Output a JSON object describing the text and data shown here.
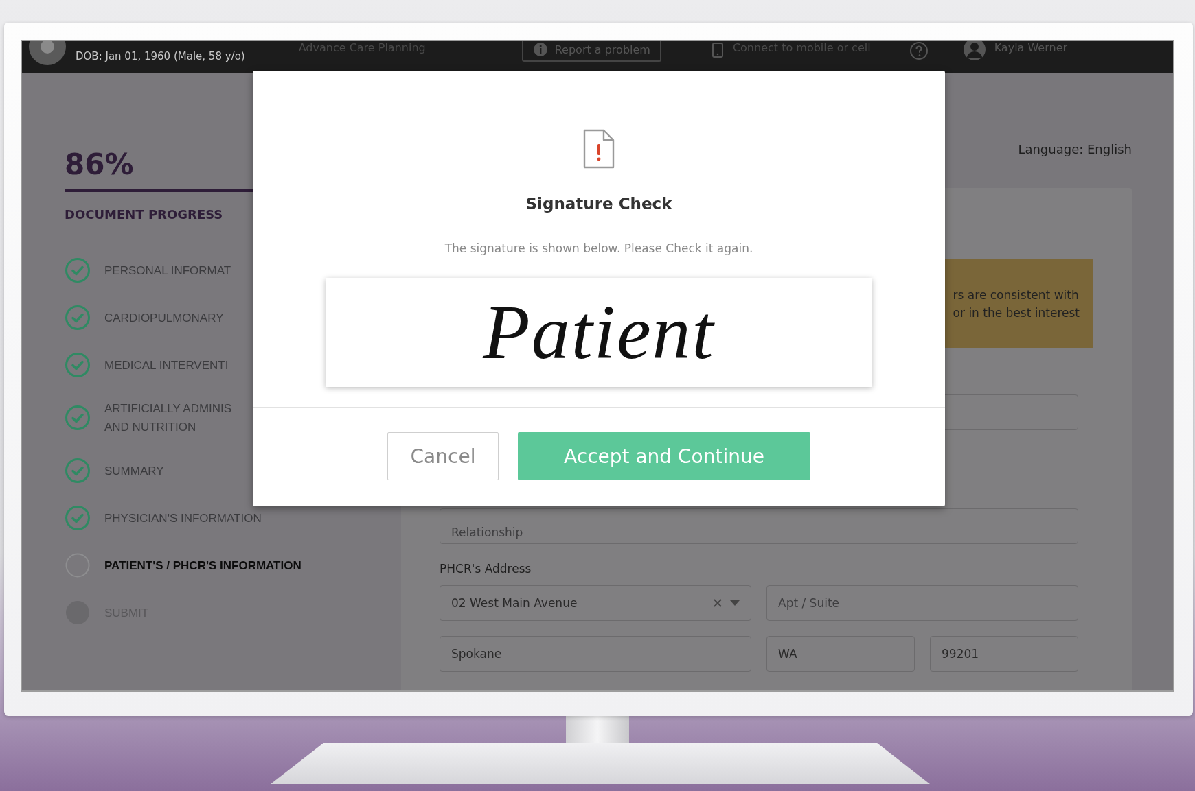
{
  "header": {
    "dob": "DOB: Jan 01, 1960 (Male, 58 y/o)",
    "title": "Advance Care Planning",
    "report_button": "Report a problem",
    "connect_link": "Connect to mobile or cell",
    "user_name": "Kayla Werner"
  },
  "progress": {
    "percent": "86%",
    "heading": "DOCUMENT PROGRESS",
    "steps": [
      {
        "label": "PERSONAL INFORMAT",
        "done": true,
        "current": false
      },
      {
        "label": "CARDIOPULMONARY",
        "done": true,
        "current": false
      },
      {
        "label": "MEDICAL INTERVENTI",
        "done": true,
        "current": false
      },
      {
        "label": "ARTIFICIALLY ADMINIS\nAND NUTRITION",
        "done": true,
        "current": false
      },
      {
        "label": "SUMMARY",
        "done": true,
        "current": false
      },
      {
        "label": "PHYSICIAN'S INFORMATION",
        "done": true,
        "current": false
      },
      {
        "label": "PATIENT'S / PHCR'S INFORMATION",
        "done": false,
        "current": true
      },
      {
        "label": "SUBMIT",
        "done": false,
        "current": false
      }
    ]
  },
  "language": "Language: English",
  "form": {
    "alert_lines": [
      "rs are consistent with",
      "or in the best interest"
    ],
    "relationship_placeholder": "Relationship",
    "address_label": "PHCR's Address",
    "street": "02 West Main Avenue",
    "apt_placeholder": "Apt / Suite",
    "city": "Spokane",
    "state": "WA",
    "zip": "99201"
  },
  "dialog": {
    "title": "Signature Check",
    "message": "The signature is shown below. Please Check it again.",
    "signature": "Patient",
    "buttons": [
      {
        "label": "Cancel",
        "kind": "secondary"
      },
      {
        "label": "Accept and Continue",
        "kind": "primary"
      }
    ]
  }
}
